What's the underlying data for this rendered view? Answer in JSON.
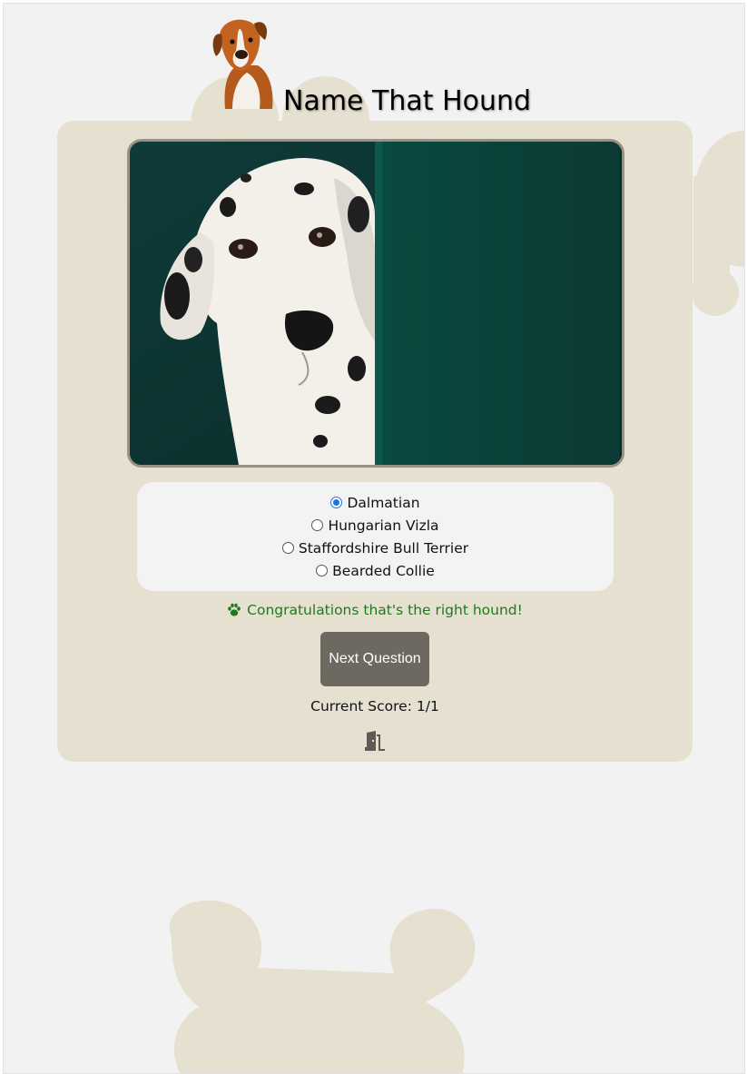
{
  "header": {
    "title": "Name That Hound"
  },
  "quiz": {
    "answers": [
      {
        "label": "Dalmatian",
        "selected": true
      },
      {
        "label": "Hungarian Vizla",
        "selected": false
      },
      {
        "label": "Staffordshire Bull Terrier",
        "selected": false
      },
      {
        "label": "Bearded Collie",
        "selected": false
      }
    ],
    "feedback": "Congratulations that's the right hound!",
    "next_button": "Next Question",
    "score_label": "Current Score:",
    "score_value": "1/1"
  },
  "icons": {
    "feedback": "paw-icon",
    "exit": "door-exit-icon"
  },
  "colors": {
    "page_background": "#f2f2f2",
    "card_background": "#e6e0d0",
    "answers_background": "#f3f3f3",
    "bone_decoration": "#e6e0d0",
    "button_background": "#6d6860",
    "feedback_text": "#1f7a1f",
    "radio_selected": "#1a73e8"
  }
}
